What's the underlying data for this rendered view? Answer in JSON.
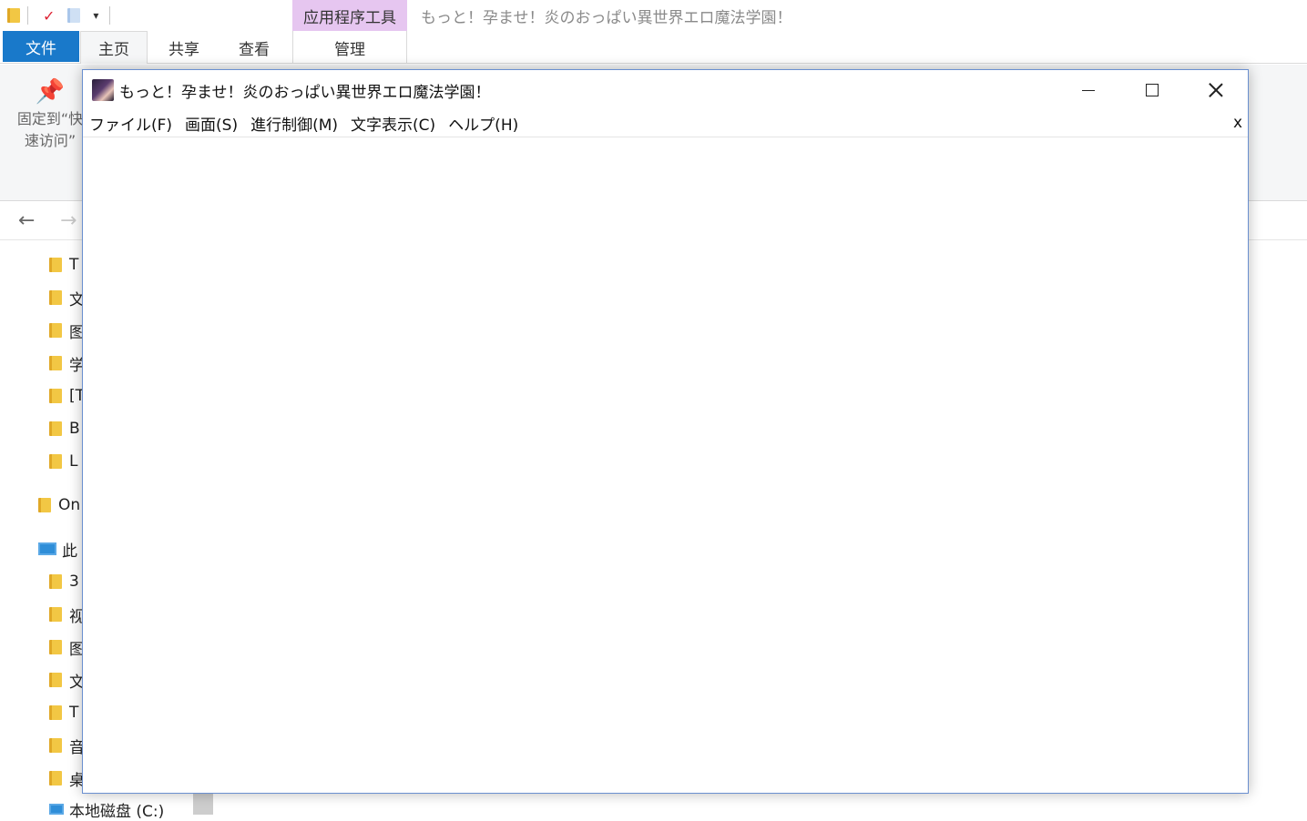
{
  "explorer": {
    "window_title": "もっと！孕ませ！炎のおっぱい異世界エロ魔法学園！",
    "context_tab_group": "应用程序工具",
    "tabs": {
      "file": "文件",
      "home": "主页",
      "share": "共享",
      "view": "查看",
      "manage": "管理"
    },
    "ribbon": {
      "pin_line1": "固定到“快",
      "pin_line2": "速访问”"
    },
    "nav": {
      "back": "←",
      "forward": "→"
    },
    "tree": [
      {
        "label": "T"
      },
      {
        "label": "文"
      },
      {
        "label": "图"
      },
      {
        "label": "学"
      },
      {
        "label": "[T"
      },
      {
        "label": "B"
      },
      {
        "label": "L"
      },
      {
        "label": "On"
      },
      {
        "label": "此"
      },
      {
        "label": "3"
      },
      {
        "label": "视"
      },
      {
        "label": "图"
      },
      {
        "label": "文"
      },
      {
        "label": "T"
      },
      {
        "label": "音"
      },
      {
        "label": "桌"
      },
      {
        "label": "本地磁盘 (C:)"
      }
    ]
  },
  "game_window": {
    "title": "もっと！孕ませ！炎のおっぱい異世界エロ魔法学園！",
    "menu": [
      "ファイル(F)",
      "画面(S)",
      "進行制御(M)",
      "文字表示(C)",
      "ヘルプ(H)"
    ],
    "menu_close": "x"
  },
  "colors": {
    "file_tab": "#1979ca",
    "context_tab": "#e6c6f0",
    "window_border": "#6a8fd0"
  }
}
